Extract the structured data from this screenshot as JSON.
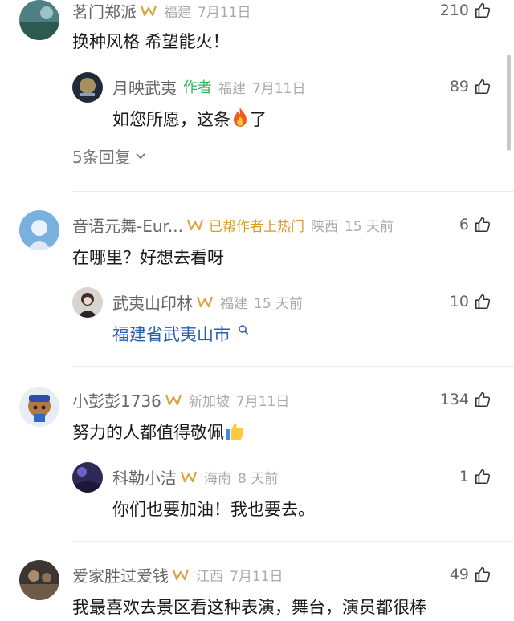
{
  "comments": [
    {
      "user": "茗门郑派",
      "location": "福建",
      "time": "7月11日",
      "likes": "210",
      "text": "换种风格 希望能火！",
      "reply": {
        "user": "月映武夷",
        "author_tag": "作者",
        "location": "福建",
        "time": "7月11日",
        "likes": "89",
        "text_before": "如您所愿，这条",
        "text_after": "了"
      },
      "more_replies": "5条回复"
    },
    {
      "user": "音语元舞-Eur...",
      "hot_tag": "已帮作者上热门",
      "location": "陕西",
      "time": "15 天前",
      "likes": "6",
      "text": "在哪里？好想去看呀",
      "reply": {
        "user": "武夷山印林",
        "location": "福建",
        "time": "15 天前",
        "likes": "10",
        "link_text": "福建省武夷山市"
      }
    },
    {
      "user": "小彭彭1736",
      "location": "新加坡",
      "time": "7月11日",
      "likes": "134",
      "text": "努力的人都值得敬佩",
      "reply": {
        "user": "科勒小洁",
        "location": "海南",
        "time": "8 天前",
        "likes": "1",
        "text": "你们也要加油！我也要去。"
      }
    },
    {
      "user": "爱家胜过爱钱",
      "location": "江西",
      "time": "7月11日",
      "likes": "49",
      "text": "我最喜欢去景区看这种表演，舞台，演员都很棒"
    }
  ],
  "colors": {
    "author_tag": "#34b15f",
    "hot_tag": "#d89a1e",
    "link": "#2a5fb0",
    "crown": "#d9a441"
  },
  "icons": {
    "like": "thumb-up-icon",
    "crown": "crown-badge-icon",
    "search": "search-icon",
    "chevron": "chevron-down-icon",
    "fire": "fire-emoji-icon",
    "thumbs": "thumbs-up-emoji-icon"
  }
}
